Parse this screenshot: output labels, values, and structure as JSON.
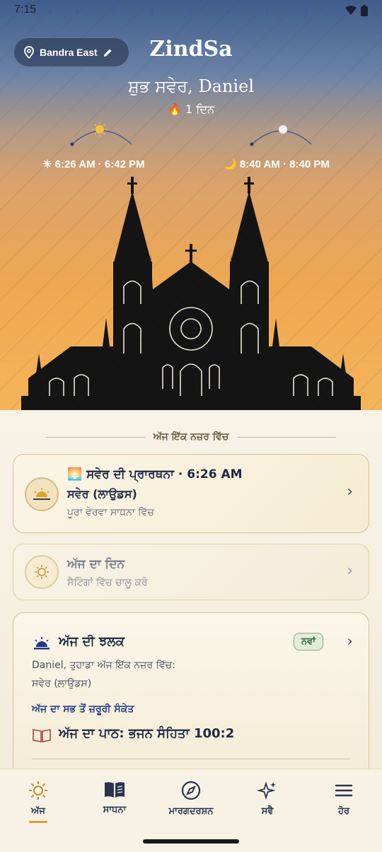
{
  "status": {
    "time": "7:15"
  },
  "header": {
    "location": "Bandra East",
    "app_title": "ZindSa",
    "greeting": "ਸ਼ੁਭ ਸਵੇਰ, Daniel",
    "streak": "🔥 1 ਦਿਨ",
    "sun_times": "☀ 6:26 AM · 6:42 PM",
    "moon_times": "🌙 8:40 AM · 8:40 PM"
  },
  "section_title": "ਅੱਜ ਇੱਕ ਨਜ਼ਰ ਵਿੱਚ",
  "prayer_card": {
    "title": "🌅 ਸਵੇਰ ਦੀ ਪ੍ਰਾਰਥਨਾ · 6:26 AM",
    "subtitle": "ਸਵੇਰ (ਲਾਉਡਸ)",
    "detail": "ਪੂਰਾ ਵੇਰਵਾ ਸਾਧਨਾ ਵਿੱਚ"
  },
  "day_card": {
    "title": "ਅੱਜ ਦਾ ਦਿਨ",
    "detail": "ਸੈਟਿੰਗਾਂ ਵਿੱਚ ਚਾਲੂ ਕਰੋ"
  },
  "glimpse_card": {
    "title": "ਅੱਜ ਦੀ ਝਲਕ",
    "badge": "ਨਵਾਂ",
    "line1": "Daniel, ਤੁਹਾਡਾ ਅੱਜ ਇੱਕ ਨਜ਼ਰ ਵਿੱਚ:",
    "line2": "ਸਵੇਰ (ਲਾਉਡਸ)",
    "signal_label": "ਅੱਜ ਦਾ ਸਭ ਤੋਂ ਜ਼ਰੂਰੀ ਸੰਕੇਤ",
    "reading": "ਅੱਜ ਦਾ ਪਾਠ: ਭਜਨ ਸੰਹਿਤਾ 100:2"
  },
  "nav": [
    {
      "label": "ਅੱਜ",
      "icon": "sun-icon"
    },
    {
      "label": "ਸਾਧਨਾ",
      "icon": "book-icon"
    },
    {
      "label": "ਮਾਰਗਦਰਸ਼ਨ",
      "icon": "compass-icon"
    },
    {
      "label": "ਸਵੈ",
      "icon": "sparkle-icon"
    },
    {
      "label": "ਹੋਰ",
      "icon": "menu-icon"
    }
  ],
  "colors": {
    "accent": "#1f3a8a",
    "gold": "#d6bf86",
    "sky_top": "#3f5d8c",
    "sky_bottom": "#f5b45a"
  }
}
